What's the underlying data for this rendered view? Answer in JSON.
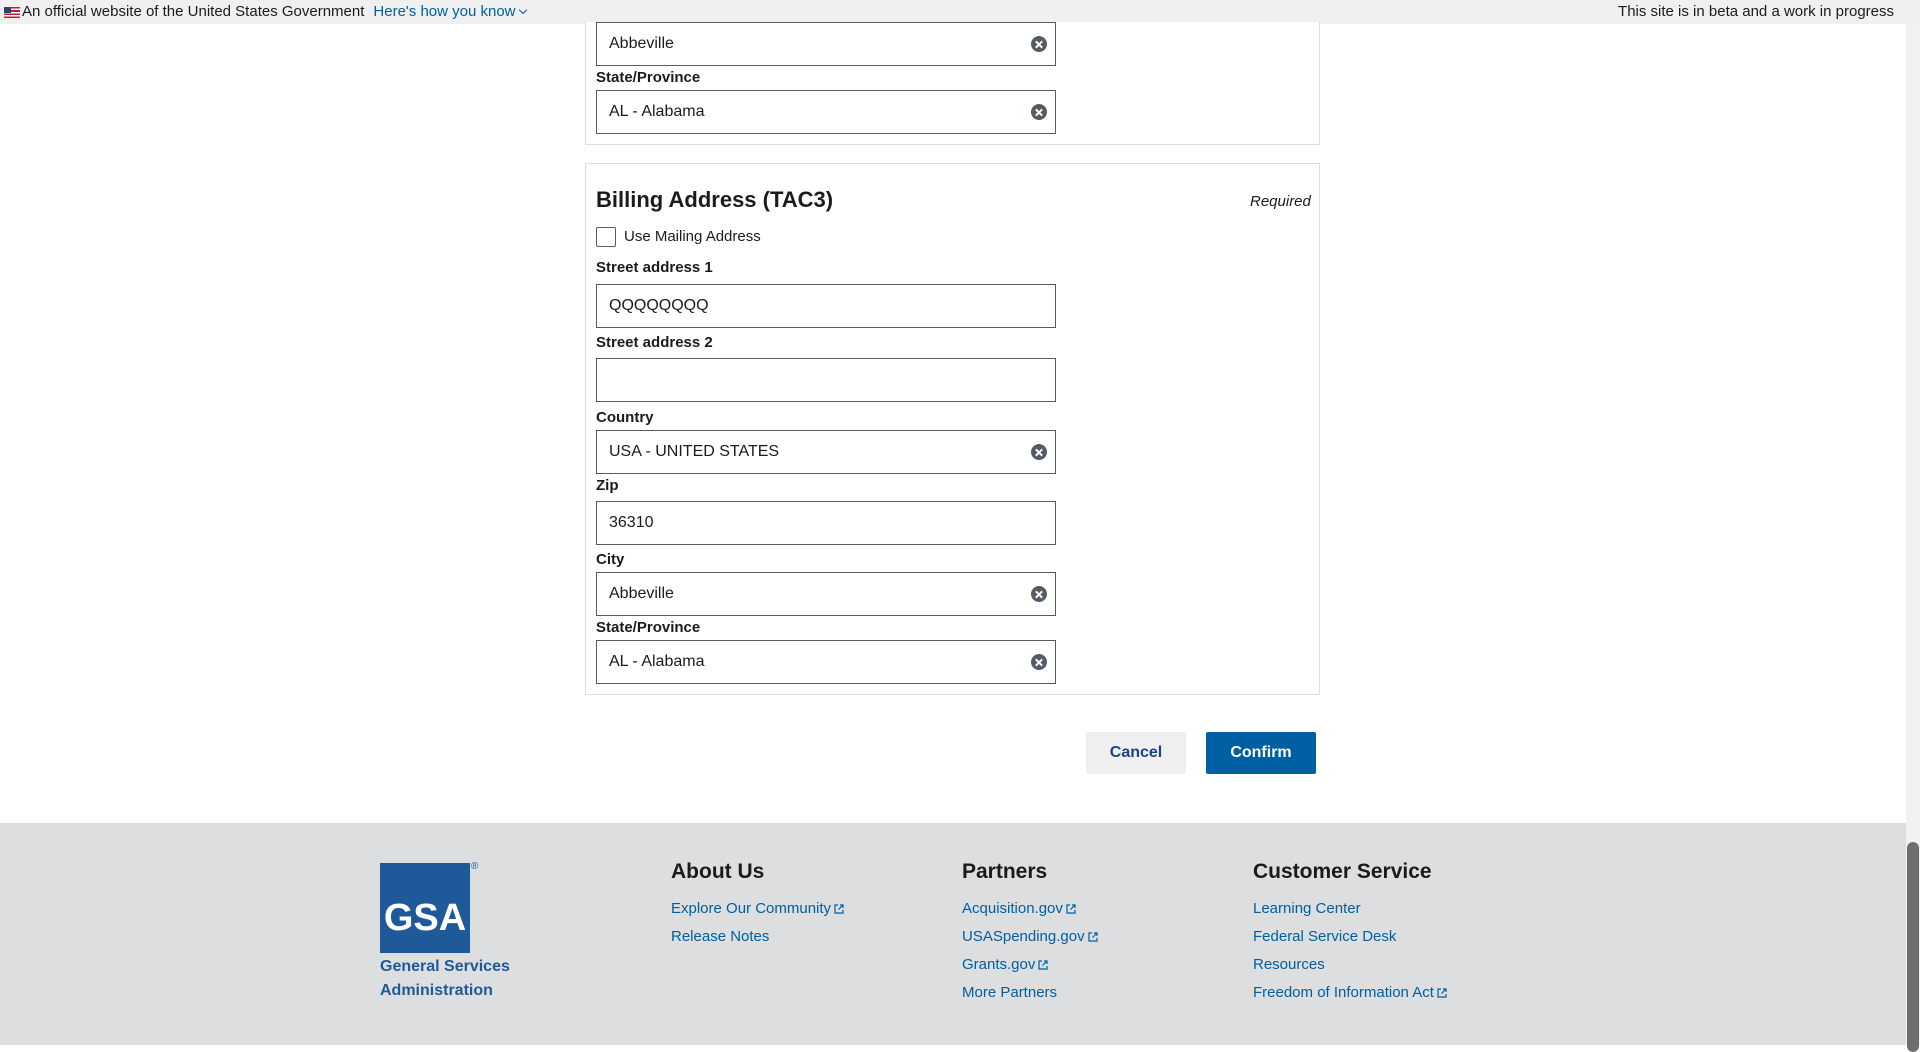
{
  "banner": {
    "official_text": "An official website of the United States Government",
    "how_you_know": "Here's how you know",
    "beta_text": "This site is in beta and a work in progress"
  },
  "mailing_partial": {
    "city_value": "Abbeville",
    "state_label": "State/Province",
    "state_value": "AL - Alabama"
  },
  "billing": {
    "title": "Billing Address (TAC3)",
    "required": "Required",
    "use_mailing_label": "Use Mailing Address",
    "use_mailing_checked": false,
    "street1_label": "Street address 1",
    "street1_value": "QQQQQQQQ",
    "street2_label": "Street address 2",
    "street2_value": "",
    "country_label": "Country",
    "country_value": "USA - UNITED STATES",
    "zip_label": "Zip",
    "zip_value": "36310",
    "city_label": "City",
    "city_value": "Abbeville",
    "state_label": "State/Province",
    "state_value": "AL - Alabama"
  },
  "actions": {
    "cancel": "Cancel",
    "confirm": "Confirm"
  },
  "footer": {
    "logo_text": "GSA",
    "logo_registered": "®",
    "agency_line1": "General Services",
    "agency_line2": "Administration",
    "about": {
      "heading": "About Us",
      "links": [
        "Explore Our Community",
        "Release Notes"
      ]
    },
    "partners": {
      "heading": "Partners",
      "links": [
        "Acquisition.gov",
        "USASpending.gov",
        "Grants.gov",
        "More Partners"
      ]
    },
    "customer_service": {
      "heading": "Customer Service",
      "links": [
        "Learning Center",
        "Federal Service Desk",
        "Resources",
        "Freedom of Information Act"
      ]
    }
  },
  "colors": {
    "link": "#005ea2",
    "primary_button": "#005ea2",
    "footer_bg": "#dcdee0",
    "gsa_blue": "#1e5a99"
  },
  "icons": {
    "banner": [
      "us-flag-icon",
      "chevron-down-icon"
    ],
    "fields": "clear-icon",
    "external": "external-link-icon"
  }
}
